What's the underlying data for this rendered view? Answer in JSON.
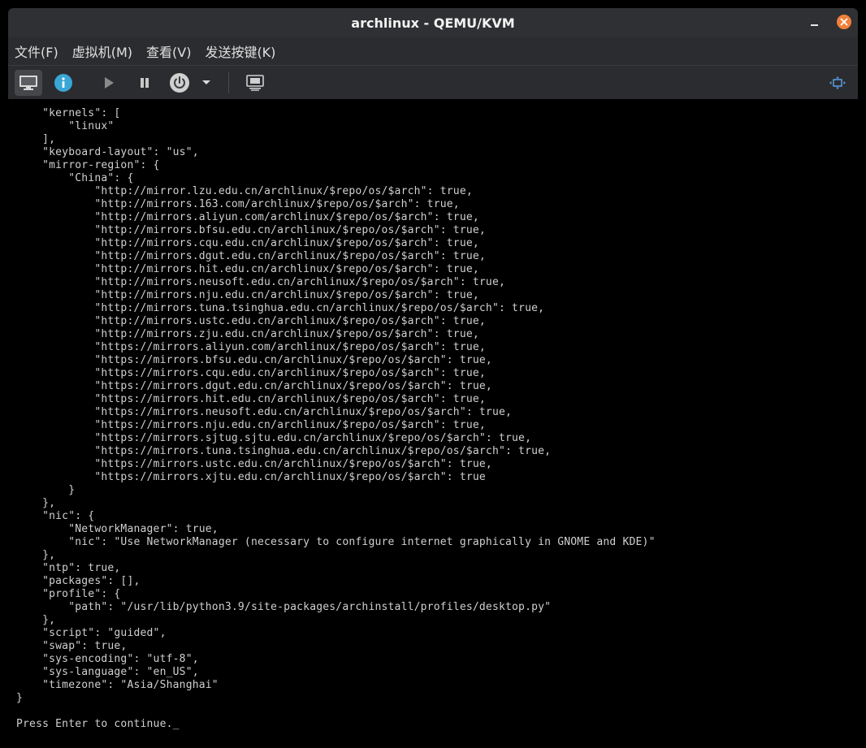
{
  "window": {
    "title": "archlinux - QEMU/KVM"
  },
  "menu": {
    "items": [
      {
        "label": "文件(F)"
      },
      {
        "label": "虚拟机(M)"
      },
      {
        "label": "查看(V)"
      },
      {
        "label": "发送按键(K)"
      }
    ]
  },
  "toolbar": {
    "buttons": [
      {
        "icon": "monitor-icon",
        "name": "show-console-button"
      },
      {
        "icon": "info-icon",
        "name": "show-details-button"
      },
      {
        "icon": "play-icon",
        "name": "run-button"
      },
      {
        "icon": "pause-icon",
        "name": "pause-button"
      },
      {
        "icon": "power-icon",
        "name": "shutdown-button"
      },
      {
        "icon": "chevron-down-icon",
        "name": "shutdown-menu-button"
      },
      {
        "icon": "snapshot-icon",
        "name": "snapshots-button"
      },
      {
        "icon": "fullscreen-icon",
        "name": "resize-button"
      }
    ]
  },
  "colors": {
    "titlebar": "#2f3033",
    "menubar": "#2b2c2f",
    "close": "#f1803a",
    "info": "#3aa6d6",
    "console_text": "#d0d0d0"
  },
  "console": {
    "lines": [
      "    \"kernels\": [",
      "        \"linux\"",
      "    ],",
      "    \"keyboard-layout\": \"us\",",
      "    \"mirror-region\": {",
      "        \"China\": {",
      "            \"http://mirror.lzu.edu.cn/archlinux/$repo/os/$arch\": true,",
      "            \"http://mirrors.163.com/archlinux/$repo/os/$arch\": true,",
      "            \"http://mirrors.aliyun.com/archlinux/$repo/os/$arch\": true,",
      "            \"http://mirrors.bfsu.edu.cn/archlinux/$repo/os/$arch\": true,",
      "            \"http://mirrors.cqu.edu.cn/archlinux/$repo/os/$arch\": true,",
      "            \"http://mirrors.dgut.edu.cn/archlinux/$repo/os/$arch\": true,",
      "            \"http://mirrors.hit.edu.cn/archlinux/$repo/os/$arch\": true,",
      "            \"http://mirrors.neusoft.edu.cn/archlinux/$repo/os/$arch\": true,",
      "            \"http://mirrors.nju.edu.cn/archlinux/$repo/os/$arch\": true,",
      "            \"http://mirrors.tuna.tsinghua.edu.cn/archlinux/$repo/os/$arch\": true,",
      "            \"http://mirrors.ustc.edu.cn/archlinux/$repo/os/$arch\": true,",
      "            \"http://mirrors.zju.edu.cn/archlinux/$repo/os/$arch\": true,",
      "            \"https://mirrors.aliyun.com/archlinux/$repo/os/$arch\": true,",
      "            \"https://mirrors.bfsu.edu.cn/archlinux/$repo/os/$arch\": true,",
      "            \"https://mirrors.cqu.edu.cn/archlinux/$repo/os/$arch\": true,",
      "            \"https://mirrors.dgut.edu.cn/archlinux/$repo/os/$arch\": true,",
      "            \"https://mirrors.hit.edu.cn/archlinux/$repo/os/$arch\": true,",
      "            \"https://mirrors.neusoft.edu.cn/archlinux/$repo/os/$arch\": true,",
      "            \"https://mirrors.nju.edu.cn/archlinux/$repo/os/$arch\": true,",
      "            \"https://mirrors.sjtug.sjtu.edu.cn/archlinux/$repo/os/$arch\": true,",
      "            \"https://mirrors.tuna.tsinghua.edu.cn/archlinux/$repo/os/$arch\": true,",
      "            \"https://mirrors.ustc.edu.cn/archlinux/$repo/os/$arch\": true,",
      "            \"https://mirrors.xjtu.edu.cn/archlinux/$repo/os/$arch\": true",
      "        }",
      "    },",
      "    \"nic\": {",
      "        \"NetworkManager\": true,",
      "        \"nic\": \"Use NetworkManager (necessary to configure internet graphically in GNOME and KDE)\"",
      "    },",
      "    \"ntp\": true,",
      "    \"packages\": [],",
      "    \"profile\": {",
      "        \"path\": \"/usr/lib/python3.9/site-packages/archinstall/profiles/desktop.py\"",
      "    },",
      "    \"script\": \"guided\",",
      "    \"swap\": true,",
      "    \"sys-encoding\": \"utf-8\",",
      "    \"sys-language\": \"en_US\",",
      "    \"timezone\": \"Asia/Shanghai\"",
      "}",
      "",
      "Press Enter to continue."
    ],
    "cursor": "_"
  }
}
